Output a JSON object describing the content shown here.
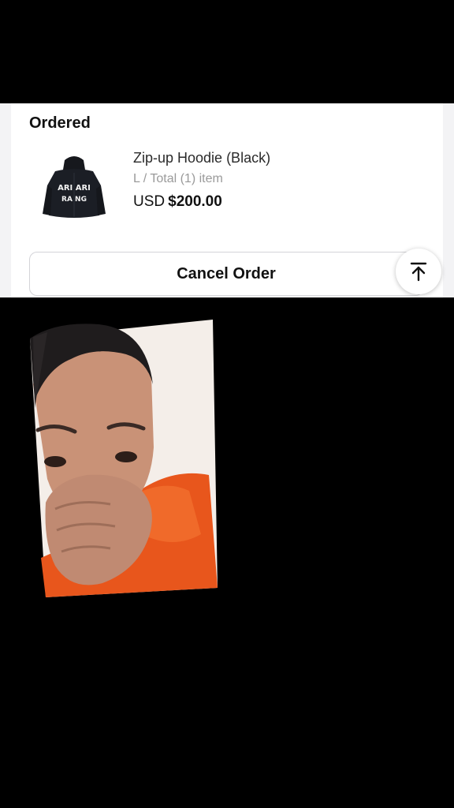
{
  "order": {
    "status_label": "Ordered",
    "item": {
      "name": "Zip-up Hoodie (Black)",
      "meta": "L / Total (1) item",
      "currency": "USD",
      "price": "$200.00",
      "thumbnail_icon": "hoodie-image",
      "thumbnail_text_line1": "ARI ARI",
      "thumbnail_text_line2": "RA NG"
    },
    "cancel_label": "Cancel Order"
  },
  "scroll_top_icon": "arrow-up-to-top-icon",
  "video_overlay": {
    "subject": "person-photo",
    "shirt_color": "#e8561c",
    "background_color": "#000000"
  }
}
